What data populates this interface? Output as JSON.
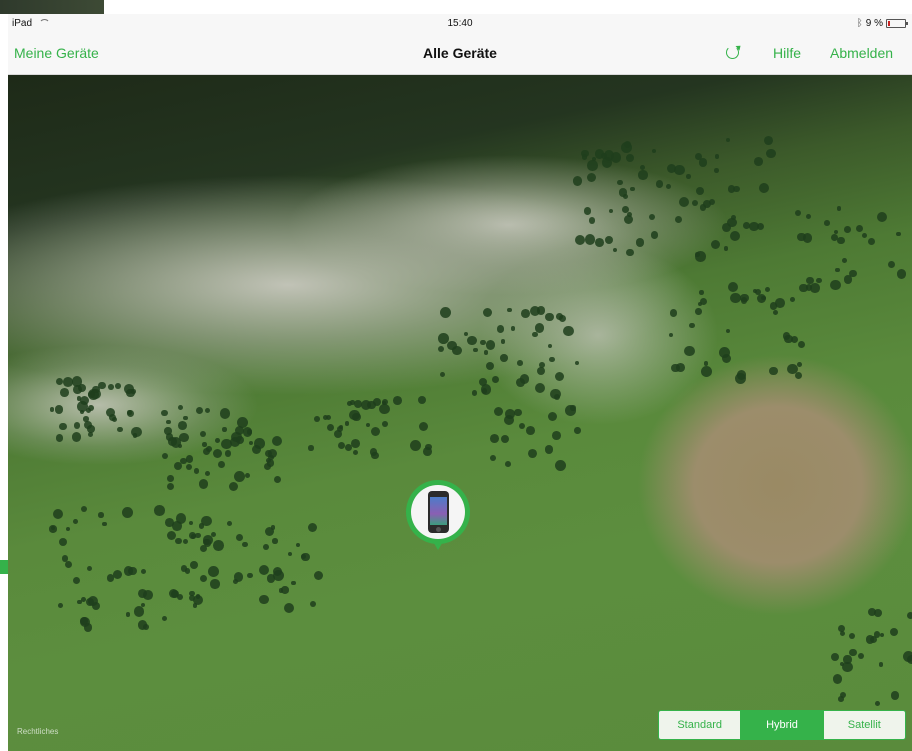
{
  "status_bar": {
    "device": "iPad",
    "time": "15:40",
    "battery": "9 %"
  },
  "nav": {
    "left_label": "Meine Geräte",
    "title": "Alle Geräte",
    "help_label": "Hilfe",
    "logout_label": "Abmelden"
  },
  "map": {
    "legal_label": "Rechtliches",
    "map_types": [
      "Standard",
      "Hybrid",
      "Satellit"
    ],
    "selected_type": "Hybrid"
  },
  "colors": {
    "accent": "#35b24a",
    "bar": "#f7f7f7"
  },
  "icons": [
    "wifi-icon",
    "bluetooth-icon",
    "battery-icon",
    "refresh-icon",
    "iphone-icon"
  ]
}
